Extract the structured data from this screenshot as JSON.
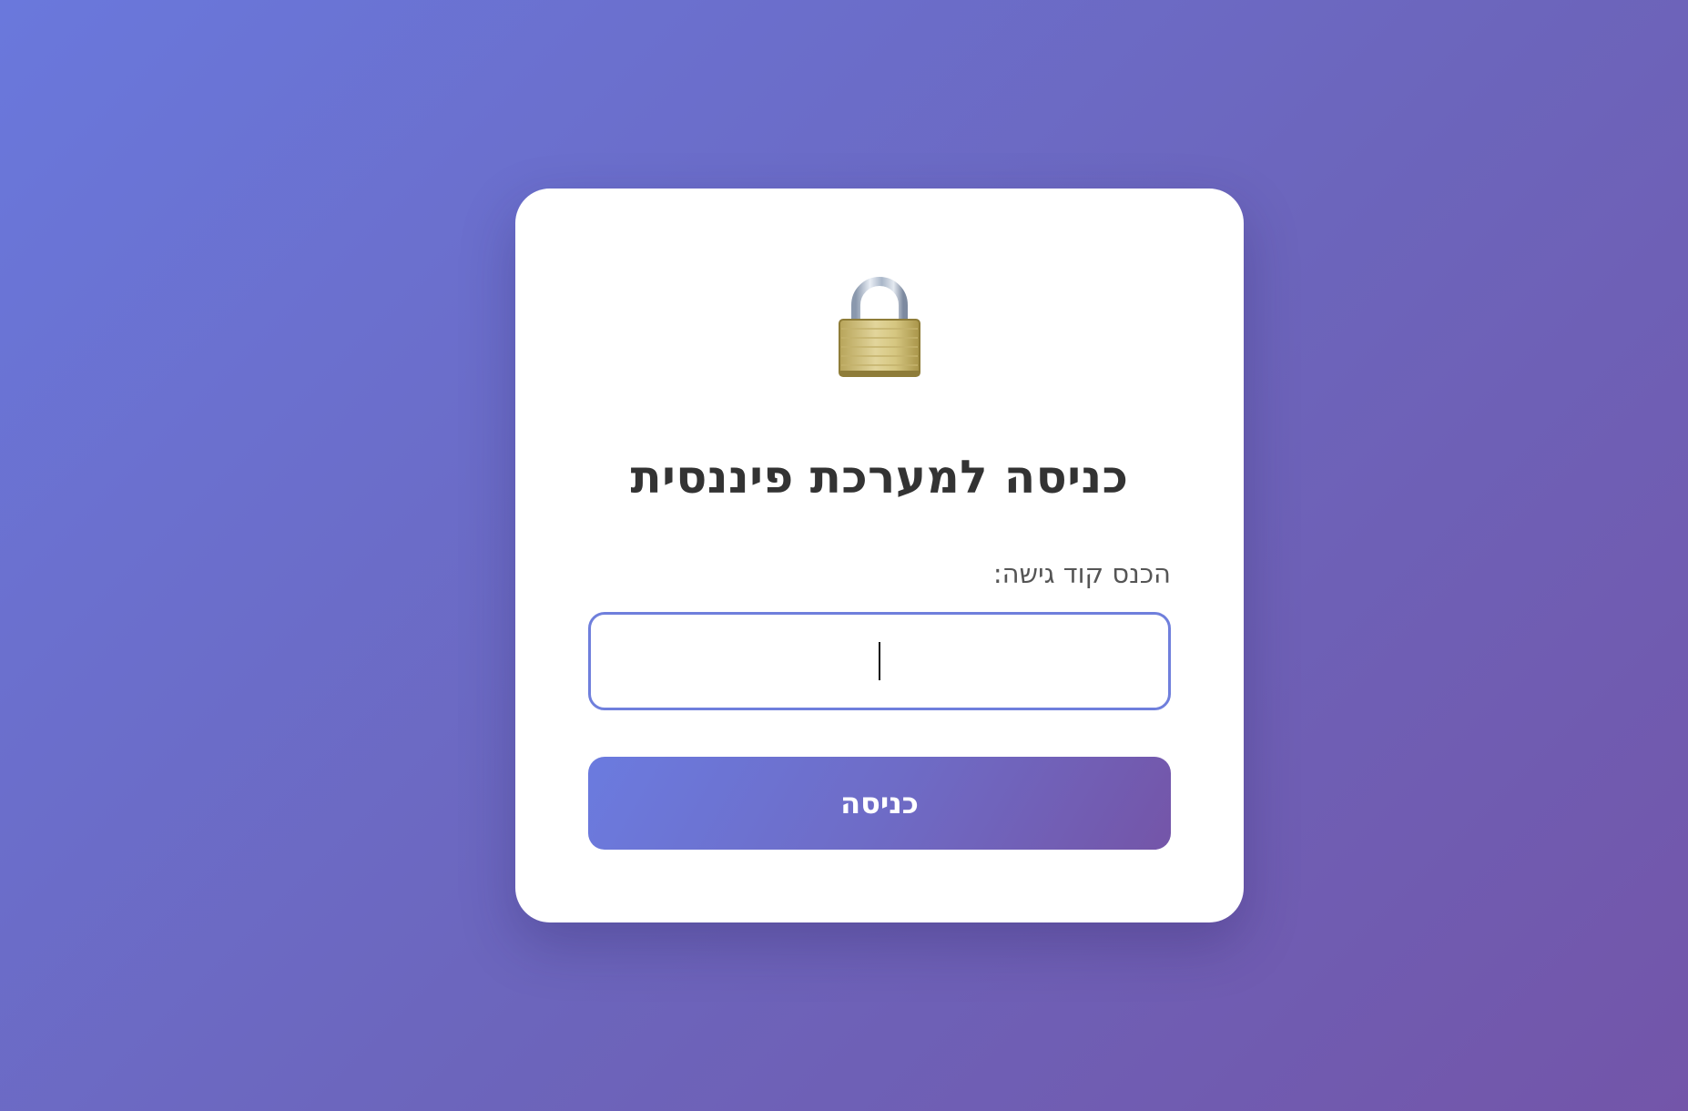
{
  "login": {
    "icon": "padlock-icon",
    "title": "כניסה למערכת פיננסית",
    "field_label": "הכנס קוד גישה:",
    "code_value": "",
    "submit_label": "כניסה"
  },
  "colors": {
    "background_start": "#6a78dc",
    "background_end": "#7355a9",
    "card": "#ffffff",
    "input_border": "#6f7fdc",
    "button_start": "#6b7bdf",
    "button_end": "#7455a8",
    "title_text": "#333333",
    "label_text": "#555555"
  }
}
